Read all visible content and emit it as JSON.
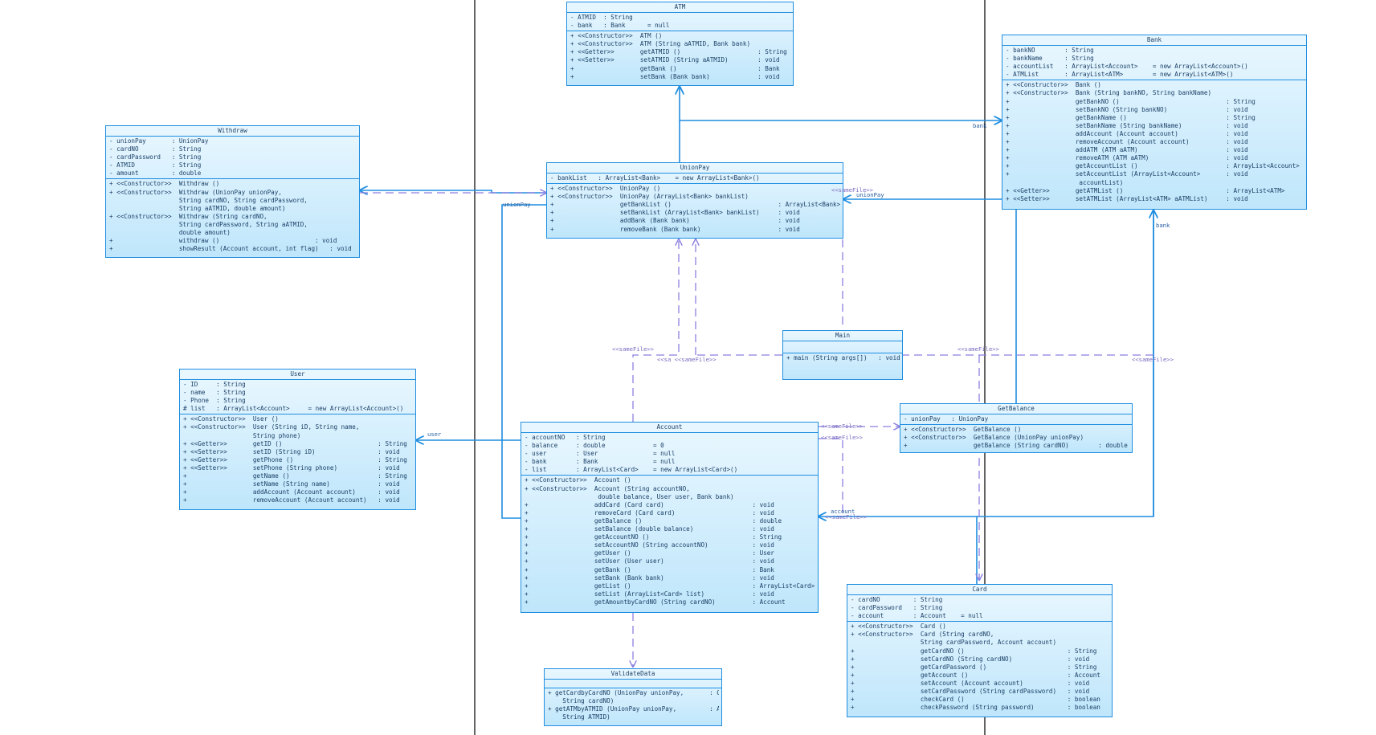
{
  "classes": {
    "atm": {
      "name": "ATM",
      "attributes": [
        "- ATMID  : String",
        "- bank   : Bank      = null"
      ],
      "methods": [
        "+ <<Constructor>>  ATM ()",
        "+ <<Constructor>>  ATM (String aATMID, Bank bank)",
        "+ <<Getter>>       getATMID ()                     : String",
        "+ <<Setter>>       setATMID (String aATMID)        : void",
        "+                  getBank ()                      : Bank",
        "+                  setBank (Bank bank)             : void"
      ]
    },
    "bank": {
      "name": "Bank",
      "attributes": [
        "- bankNO        : String",
        "- bankName      : String",
        "- accountList   : ArrayList<Account>    = new ArrayList<Account>()",
        "- ATMList       : ArrayList<ATM>        = new ArrayList<ATM>()"
      ],
      "methods": [
        "+ <<Constructor>>  Bank ()",
        "+ <<Constructor>>  Bank (String bankNO, String bankName)",
        "+                  getBankNO ()                             : String",
        "+                  setBankNO (String bankNO)                : void",
        "+                  getBankName ()                           : String",
        "+                  setBankName (String bankName)            : void",
        "+                  addAccount (Account account)             : void",
        "+                  removeAccount (Account account)          : void",
        "+                  addATM (ATM aATM)                        : void",
        "+                  removeATM (ATM aATM)                     : void",
        "+                  getAccountList ()                        : ArrayList<Account>",
        "+                  setAccountList (ArrayList<Account>       : void",
        "                    accountList)",
        "+ <<Getter>>       getATMList ()                            : ArrayList<ATM>",
        "+ <<Setter>>       setATMList (ArrayList<ATM> aATMList)     : void"
      ]
    },
    "withdraw": {
      "name": "Withdraw",
      "attributes": [
        "- unionPay       : UnionPay",
        "- cardNO         : String",
        "- cardPassword   : String",
        "- ATMID          : String",
        "- amount         : double"
      ],
      "methods": [
        "+ <<Constructor>>  Withdraw ()",
        "+ <<Constructor>>  Withdraw (UnionPay unionPay,",
        "                   String cardNO, String cardPassword,",
        "                   String aATMID, double amount)",
        "+ <<Constructor>>  Withdraw (String cardNO,",
        "                   String cardPassword, String aATMID,",
        "                   double amount)",
        "+                  withdraw ()                          : void",
        "+                  showResult (Account account, int flag)   : void"
      ]
    },
    "unionpay": {
      "name": "UnionPay",
      "attributes": [
        "- bankList   : ArrayList<Bank>    = new ArrayList<Bank>()"
      ],
      "methods": [
        "+ <<Constructor>>  UnionPay ()",
        "+ <<Constructor>>  UnionPay (ArrayList<Bank> bankList)",
        "+                  getBankList ()                             : ArrayList<Bank>",
        "+                  setBankList (ArrayList<Bank> bankList)     : void",
        "+                  addBank (Bank bank)                        : void",
        "+                  removeBank (Bank bank)                     : void"
      ]
    },
    "main": {
      "name": "Main",
      "attributes": [],
      "methods": [
        "+ main (String args[])   : void"
      ]
    },
    "user": {
      "name": "User",
      "attributes": [
        "- ID     : String",
        "- name   : String",
        "- Phone  : String",
        "# list   : ArrayList<Account>     = new ArrayList<Account>()"
      ],
      "methods": [
        "+ <<Constructor>>  User ()",
        "+ <<Constructor>>  User (String iD, String name,",
        "                   String phone)",
        "+ <<Getter>>       getID ()                          : String",
        "+ <<Setter>>       setID (String iD)                 : void",
        "+ <<Getter>>       getPhone ()                       : String",
        "+ <<Setter>>       setPhone (String phone)           : void",
        "+                  getName ()                        : String",
        "+                  setName (String name)             : void",
        "+                  addAccount (Account account)      : void",
        "+                  removeAccount (Account account)   : void"
      ]
    },
    "account": {
      "name": "Account",
      "attributes": [
        "- accountNO   : String",
        "- balance     : double             = 0",
        "- user        : User               = null",
        "- bank        : Bank               = null",
        "- list        : ArrayList<Card>    = new ArrayList<Card>()"
      ],
      "methods": [
        "+ <<Constructor>>  Account ()",
        "+ <<Constructor>>  Account (String accountNO,",
        "                    double balance, User user, Bank bank)",
        "+                  addCard (Card card)                        : void",
        "+                  removeCard (Card card)                     : void",
        "+                  getBalance ()                              : double",
        "+                  setBalance (double balance)                : void",
        "+                  getAccountNO ()                            : String",
        "+                  setAccountNO (String accountNO)            : void",
        "+                  getUser ()                                 : User",
        "+                  setUser (User user)                        : void",
        "+                  getBank ()                                 : Bank",
        "+                  setBank (Bank bank)                        : void",
        "+                  getList ()                                 : ArrayList<Card>",
        "+                  setList (ArrayList<Card> list)             : void",
        "+                  getAmountbyCardNO (String cardNO)          : Account"
      ]
    },
    "getbalance": {
      "name": "GetBalance",
      "attributes": [
        "- unionPay   : UnionPay"
      ],
      "methods": [
        "+ <<Constructor>>  GetBalance ()",
        "+ <<Constructor>>  GetBalance (UnionPay unionPay)",
        "+                  getBalance (String cardNO)        : double"
      ]
    },
    "card": {
      "name": "Card",
      "attributes": [
        "- cardNO         : String",
        "- cardPassword   : String",
        "- account        : Account    = null"
      ],
      "methods": [
        "+ <<Constructor>>  Card ()",
        "+ <<Constructor>>  Card (String cardNO,",
        "                   String cardPassword, Account account)",
        "+                  getCardNO ()                            : String",
        "+                  setCardNO (String cardNO)               : void",
        "+                  getCardPassword ()                      : String",
        "+                  getAccount ()                           : Account",
        "+                  setAccount (Account account)            : void",
        "+                  setCardPassword (String cardPassword)   : void",
        "+                  checkCard ()                            : boolean",
        "+                  checkPassword (String password)         : boolean"
      ]
    },
    "validatedata": {
      "name": "ValidateData",
      "attributes": [],
      "methods": [
        "+ getCardbyCardNO (UnionPay unionPay,       : Card",
        "    String cardNO)",
        "+ getATMbyATMID (UnionPay unionPay,         : ATM",
        "    String ATMID)"
      ]
    }
  },
  "labels": {
    "bank_atm": "bank",
    "unionpay_withdraw": "unionPay",
    "samefile_unionpay_right": "<<sameFile>>",
    "unionpay_getbalance": "unionPay",
    "bank_account": "bank",
    "samefile_left": "<<sameFile>>",
    "samefile_mid": "<<sa <<sameFile>>",
    "samefile_right1": "<<sameFile>>",
    "samefile_right2": "<<sameFile>>",
    "user_account": "user",
    "samefile_acc_gb1": "<<sameFile>>",
    "samefile_acc_gb2": "<<sameFile>>",
    "account_card": "account",
    "samefile_acc_card": "<<sameFile>>"
  }
}
